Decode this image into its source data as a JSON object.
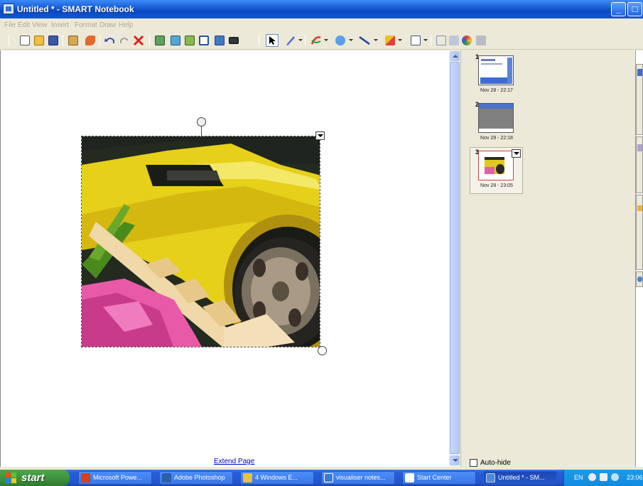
{
  "window": {
    "title": "Untitled * - SMART Notebook",
    "min_glyph": "_",
    "max_glyph": "□"
  },
  "menu": [
    "File",
    "Edit",
    "View",
    "Insert",
    "Format",
    "Draw",
    "Help"
  ],
  "toolbar": {
    "icons": [
      "new-page-icon",
      "open-icon",
      "save-icon",
      "paste-icon",
      "properties-icon",
      "undo-icon",
      "redo-icon",
      "delete-icon",
      "screen-shade-icon",
      "full-screen-icon",
      "insert-icon",
      "table-icon",
      "capture-icon",
      "camera-icon",
      "select-icon",
      "pen-icon",
      "creative-pen-icon",
      "eraser-icon",
      "line-icon",
      "shape-icon",
      "fill-icon",
      "more-tools-icon"
    ]
  },
  "canvas": {
    "extend_link": "Extend Page"
  },
  "sorter": {
    "pages": [
      {
        "num": "1",
        "date": "Nov 28 - 22:17"
      },
      {
        "num": "2",
        "date": "Nov 28 - 22:18"
      },
      {
        "num": "3",
        "date": "Nov 28 - 23:05"
      }
    ],
    "selected_page": "3",
    "autohide_label": "Auto-hide",
    "autohide_checked": false
  },
  "taskbar": {
    "start_label": "start",
    "tasks": [
      {
        "label": "Microsoft Powe...",
        "color": "#d8401c"
      },
      {
        "label": "Adobe Photoshop",
        "color": "#2c5fa8"
      },
      {
        "label": "4 Windows E...",
        "color": "#e8c43c"
      },
      {
        "label": "visualiser notes...",
        "color": "#3c78d8"
      },
      {
        "label": "Start Center",
        "color": "#ffffff"
      },
      {
        "label": "Untitled * - SM...",
        "color": "#4a8ae0"
      }
    ],
    "active_task": 5,
    "language": "EN",
    "time": "23:06"
  },
  "colors": {
    "titlebar": "#0a48c4",
    "taskbar": "#245ed8",
    "start_green": "#3c8e3c",
    "selection_border": "#d04040",
    "car_yellow": "#e8d21c"
  }
}
